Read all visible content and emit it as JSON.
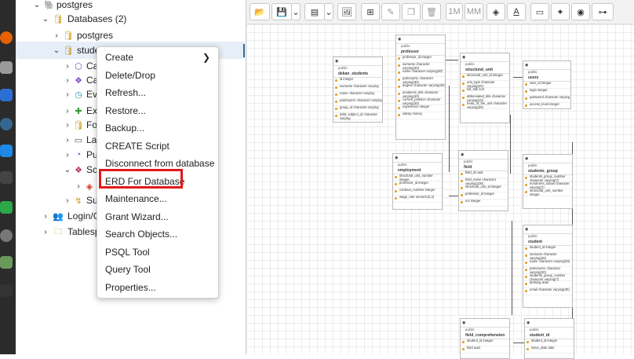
{
  "tree": {
    "rows": [
      {
        "label": "postgres",
        "level": "server"
      },
      {
        "label": "Databases (2)",
        "level": "group"
      },
      {
        "label": "postgres",
        "level": "db"
      },
      {
        "label": "stude",
        "level": "db-selected"
      },
      {
        "label": "Ca",
        "level": "child"
      },
      {
        "label": "Ca",
        "level": "child"
      },
      {
        "label": "Ev",
        "level": "child"
      },
      {
        "label": "Ex",
        "level": "child"
      },
      {
        "label": "Fo",
        "level": "child"
      },
      {
        "label": "La",
        "level": "child"
      },
      {
        "label": "Pu",
        "level": "child"
      },
      {
        "label": "Sc",
        "level": "child"
      },
      {
        "label": "",
        "level": "grandchild"
      },
      {
        "label": "Su",
        "level": "child"
      },
      {
        "label": "Login/G",
        "level": "group"
      },
      {
        "label": "Tablesp",
        "level": "group"
      }
    ]
  },
  "context_menu": {
    "items": [
      {
        "label": "Create",
        "submenu": "❯"
      },
      {
        "label": "Delete/Drop"
      },
      {
        "label": "Refresh..."
      },
      {
        "label": "Restore..."
      },
      {
        "label": "Backup..."
      },
      {
        "label": "CREATE Script"
      },
      {
        "label": "Disconnect from database"
      },
      {
        "label": "ERD For Database",
        "highlighted": true
      },
      {
        "label": "Maintenance..."
      },
      {
        "label": "Grant Wizard..."
      },
      {
        "label": "Search Objects..."
      },
      {
        "label": "PSQL Tool"
      },
      {
        "label": "Query Tool"
      },
      {
        "label": "Properties..."
      }
    ]
  },
  "toolbar": {
    "zoom_1m": "1M",
    "zoom_mm": "MM",
    "buttons": [
      "folder-open-icon",
      "save-icon",
      "chevron-down-icon",
      "sql-icon",
      "chevron-down-icon",
      "image-icon",
      "add-table-icon",
      "edit-icon",
      "clone-icon",
      "delete-icon",
      "zoom-1m",
      "zoom-mm",
      "fill-color-icon",
      "text-color-icon",
      "note-icon",
      "auto-align-icon",
      "show-details-icon",
      "layout-icon"
    ]
  },
  "erd": {
    "tables": [
      {
        "schema": "public",
        "name": "dekan_students",
        "cols": [
          "id integer",
          "surname character varying",
          "name character varying",
          "patronymic character varying",
          "group_id character varying",
          "debt_subject_id character varying"
        ]
      },
      {
        "schema": "public",
        "name": "professor",
        "cols": [
          "professor_id integer",
          "surname character varying(30)",
          "name character varying(30)",
          "patronymic character varying(30)",
          "degree character varying(30)",
          "academic_title character varying(40)",
          "current_position character varying(40)",
          "experience integer",
          "salary money"
        ]
      },
      {
        "schema": "public",
        "name": "structural_unit",
        "cols": [
          "structural_unit_id integer",
          "unit_type character varying(20)",
          "full_title text",
          "abbreviated_title character varying(10)",
          "head_of_the_unit character varying(30)"
        ]
      },
      {
        "schema": "public",
        "name": "users",
        "cols": [
          "user_id integer",
          "login integer",
          "password character varying",
          "access_level integer"
        ]
      },
      {
        "schema": "public",
        "name": "employment",
        "cols": [
          "structural_unit_number integer",
          "professor_id integer",
          "contract_number integer",
          "wage_rate numeric(2,2)"
        ]
      },
      {
        "schema": "public",
        "name": "field",
        "cols": [
          "field_id uuid",
          "field_name character varying(100)",
          "structural_unit_id integer",
          "professor_id integer",
          "uni integer"
        ]
      },
      {
        "schema": "public",
        "name": "students_group",
        "cols": [
          "students_group_number character varying(7)",
          "enrolment_status character varying(7)",
          "structural_unit_number integer"
        ]
      },
      {
        "schema": "public",
        "name": "student",
        "cols": [
          "student_id integer",
          "surname character varying(30)",
          "name character varying(30)",
          "patronymic character varying(30)",
          "students_group_number character varying(7)",
          "birthday date",
          "email character varying(30)"
        ]
      },
      {
        "schema": "public",
        "name": "field_comprehension",
        "cols": [
          "student_id integer",
          "field uuid"
        ]
      },
      {
        "schema": "public",
        "name": "student_id",
        "cols": [
          "student_id integer",
          "issue_date date"
        ]
      }
    ]
  }
}
